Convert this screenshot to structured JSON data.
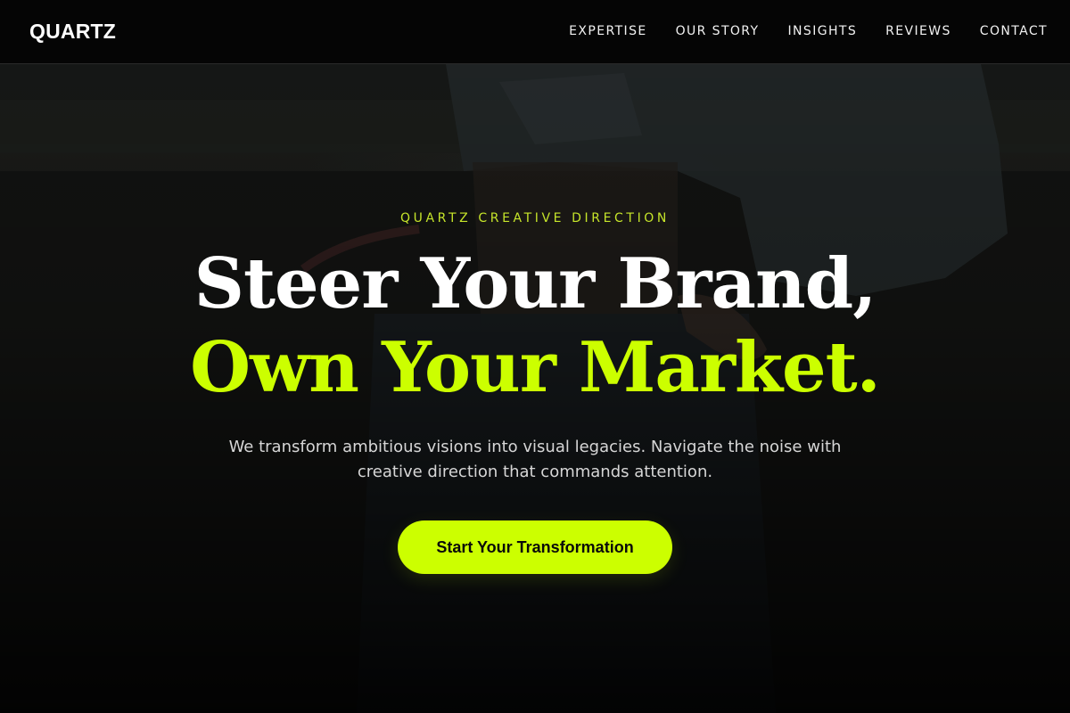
{
  "brand": {
    "logo": "QUARTZ",
    "accent_color": "#ccff00"
  },
  "nav": {
    "items": [
      {
        "label": "EXPERTISE"
      },
      {
        "label": "OUR STORY"
      },
      {
        "label": "INSIGHTS"
      },
      {
        "label": "REVIEWS"
      },
      {
        "label": "CONTACT"
      }
    ]
  },
  "hero": {
    "eyebrow": "QUARTZ CREATIVE DIRECTION",
    "headline_line1": "Steer Your Brand,",
    "headline_line2": "Own Your Market.",
    "subtitle": "We transform ambitious visions into visual legacies. Navigate the noise with creative direction that commands attention.",
    "cta_label": "Start Your Transformation",
    "background_image": "person in denim jacket leaning on wall (dark photo)"
  }
}
